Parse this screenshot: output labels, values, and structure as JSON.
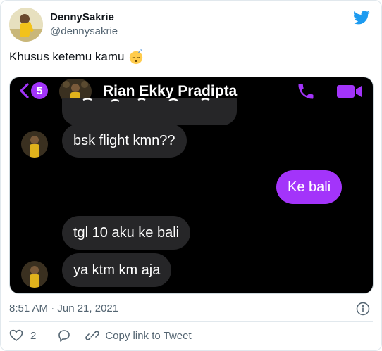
{
  "author": {
    "display_name": "DennySakrie",
    "handle": "@dennysakrie"
  },
  "tweet": {
    "text": "Khusus ketemu kamu",
    "emoji": "sleeping-face-emoji"
  },
  "chat": {
    "unread_badge": "5",
    "contact_name": "Rian Ekky Pradipta",
    "partial_message": "",
    "messages": [
      {
        "from": "them",
        "text": "bsk flight kmn??"
      },
      {
        "from": "me",
        "text": "Ke bali"
      },
      {
        "from": "them",
        "text": "tgl 10 aku ke bali"
      },
      {
        "from": "them",
        "text": "ya ktm km aja"
      }
    ],
    "colors": {
      "accent": "#a334fa",
      "received_bubble": "#262628",
      "background": "#000000"
    }
  },
  "meta": {
    "timestamp": "8:51 AM · Jun 21, 2021"
  },
  "actions": {
    "like_count": "2",
    "copy_link_label": "Copy link to Tweet"
  },
  "colors": {
    "twitter_blue": "#1d9bf0",
    "secondary_text": "#536471"
  }
}
